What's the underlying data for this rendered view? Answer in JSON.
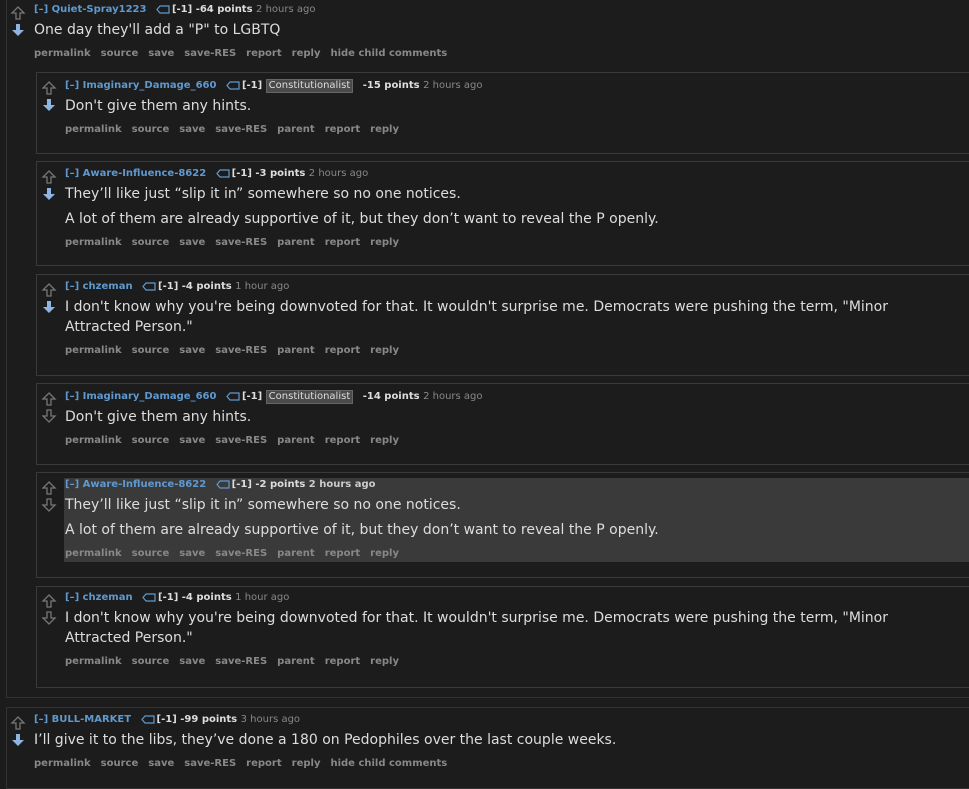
{
  "comments": [
    {
      "expand": "[–]",
      "author": "Quiet-Spray1223",
      "tag": "[-1]",
      "score": "-64 points",
      "time": "2 hours ago",
      "body": [
        "One day they'll add a \"P\" to LGBTQ"
      ],
      "buttons": [
        "permalink",
        "source",
        "save",
        "save-RES",
        "report",
        "reply",
        "hide child comments"
      ]
    },
    {
      "expand": "[–]",
      "author": "Imaginary_Damage_660",
      "tag": "[-1]",
      "flair": "Constitutionalist",
      "score": "-15 points",
      "time": "2 hours ago",
      "body": [
        "Don't give them any hints."
      ],
      "buttons": [
        "permalink",
        "source",
        "save",
        "save-RES",
        "parent",
        "report",
        "reply"
      ]
    },
    {
      "expand": "[–]",
      "author": "Aware-Influence-8622",
      "tag": "[-1]",
      "score": "-3 points",
      "time": "2 hours ago",
      "body": [
        "They’ll like just “slip it in” somewhere so no one notices.",
        "A lot of them are already supportive of it, but they don’t want to reveal the P openly."
      ],
      "buttons": [
        "permalink",
        "source",
        "save",
        "save-RES",
        "parent",
        "report",
        "reply"
      ]
    },
    {
      "expand": "[–]",
      "author": "chzeman",
      "tag": "[-1]",
      "score": "-4 points",
      "time": "1 hour ago",
      "body": [
        "I don't know why you're being downvoted for that. It wouldn't surprise me. Democrats were pushing the term, \"Minor",
        "Attracted Person.\""
      ],
      "buttons": [
        "permalink",
        "source",
        "save",
        "save-RES",
        "parent",
        "report",
        "reply"
      ]
    },
    {
      "expand": "[–]",
      "author": "Imaginary_Damage_660",
      "tag": "[-1]",
      "flair": "Constitutionalist",
      "score": "-14 points",
      "time": "2 hours ago",
      "body": [
        "Don't give them any hints."
      ],
      "buttons": [
        "permalink",
        "source",
        "save",
        "save-RES",
        "parent",
        "report",
        "reply"
      ]
    },
    {
      "expand": "[–]",
      "author": "Aware-Influence-8622",
      "tag": "[-1]",
      "score": "-2 points",
      "time": "2 hours ago",
      "body": [
        "They’ll like just “slip it in” somewhere so no one notices.",
        "A lot of them are already supportive of it, but they don’t want to reveal the P openly."
      ],
      "buttons": [
        "permalink",
        "source",
        "save",
        "save-RES",
        "parent",
        "report",
        "reply"
      ]
    },
    {
      "expand": "[–]",
      "author": "chzeman",
      "tag": "[-1]",
      "score": "-4 points",
      "time": "1 hour ago",
      "body": [
        "I don't know why you're being downvoted for that. It wouldn't surprise me. Democrats were pushing the term, \"Minor",
        "Attracted Person.\""
      ],
      "buttons": [
        "permalink",
        "source",
        "save",
        "save-RES",
        "parent",
        "report",
        "reply"
      ]
    },
    {
      "expand": "[–]",
      "author": "BULL-MARKET",
      "tag": "[-1]",
      "score": "-99 points",
      "time": "3 hours ago",
      "body": [
        "I’ll give it to the libs, they’ve done a 180 on Pedophiles over the last couple weeks."
      ],
      "buttons": [
        "permalink",
        "source",
        "save",
        "save-RES",
        "report",
        "reply",
        "hide child comments"
      ]
    }
  ],
  "colors": {
    "background": "#1c1c1c",
    "link": "#5f99cf",
    "downvote": "#8fb4e0",
    "muted": "#888888"
  }
}
